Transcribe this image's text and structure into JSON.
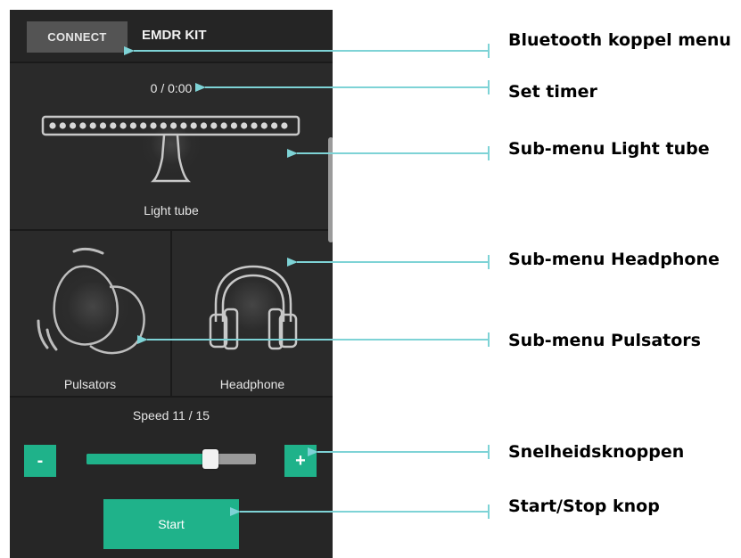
{
  "topbar": {
    "connect_label": "CONNECT",
    "app_title": "EMDR KIT"
  },
  "light_tube": {
    "timer_text": "0 / 0:00",
    "label": "Light tube"
  },
  "pulsators": {
    "label": "Pulsators"
  },
  "headphone": {
    "label": "Headphone"
  },
  "speed": {
    "label": "Speed 11 / 15",
    "current": 11,
    "max": 15,
    "minus_label": "-",
    "plus_label": "+"
  },
  "start": {
    "label": "Start"
  },
  "annotations": {
    "bluetooth": "Bluetooth koppel menu",
    "timer": "Set timer",
    "light_tube": "Sub-menu Light tube",
    "headphone": "Sub-menu Headphone",
    "pulsators": "Sub-menu Pulsators",
    "speed_buttons": "Snelheidsknoppen",
    "start_stop": "Start/Stop knop"
  },
  "colors": {
    "accent": "#1fb28a",
    "arrow": "#7ed3d6",
    "background": "#262626"
  }
}
